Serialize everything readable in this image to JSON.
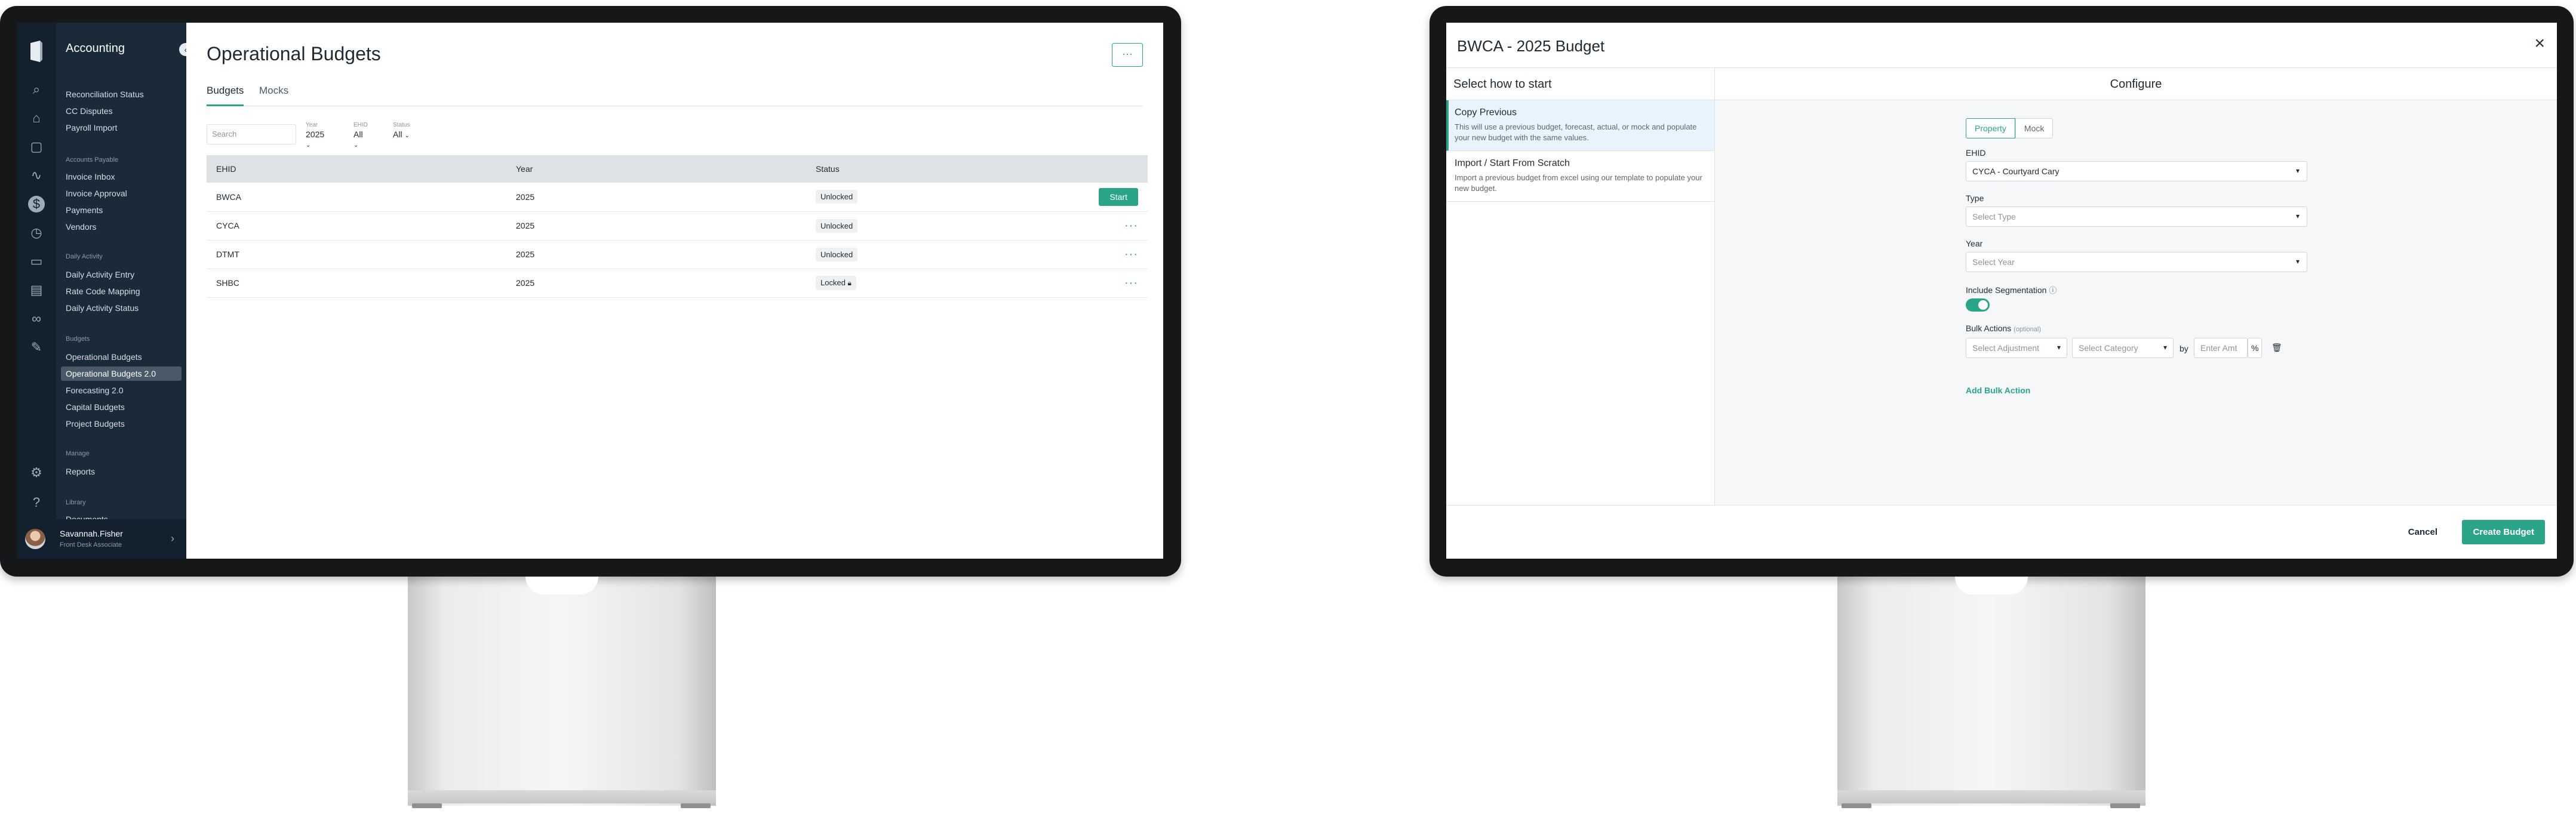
{
  "left_app": {
    "app_title": "Accounting",
    "sidebar": {
      "sections": [
        {
          "title": "",
          "items": [
            "Reconciliation Status",
            "CC Disputes",
            "Payroll Import"
          ]
        },
        {
          "title": "Accounts Payable",
          "items": [
            "Invoice Inbox",
            "Invoice Approval",
            "Payments",
            "Vendors"
          ]
        },
        {
          "title": "Daily Activity",
          "items": [
            "Daily Activity Entry",
            "Rate Code Mapping",
            "Daily Activity Status"
          ]
        },
        {
          "title": "Budgets",
          "items": [
            "Operational Budgets",
            "Operational Budgets 2.0",
            "Forecasting 2.0",
            "Capital Budgets",
            "Project Budgets"
          ]
        },
        {
          "title": "Manage",
          "items": [
            "Reports"
          ]
        },
        {
          "title": "Library",
          "items": [
            "Documents"
          ]
        }
      ],
      "selected_item": "Operational Budgets 2.0"
    },
    "user": {
      "name": "Savannah.Fisher",
      "role": "Front Desk Associate"
    },
    "page_title": "Operational Budgets",
    "more_label": "···",
    "tabs": [
      {
        "label": "Budgets",
        "active": true
      },
      {
        "label": "Mocks",
        "active": false
      }
    ],
    "search_placeholder": "Search",
    "filters": [
      {
        "label": "Year",
        "value": "2025"
      },
      {
        "label": "EHID",
        "value": "All"
      },
      {
        "label": "Status",
        "value": "All"
      }
    ],
    "table": {
      "columns": [
        "EHID",
        "Year",
        "Status"
      ],
      "rows": [
        {
          "ehid": "BWCA",
          "year": "2025",
          "status": "Unlocked",
          "action": "Start"
        },
        {
          "ehid": "CYCA",
          "year": "2025",
          "status": "Unlocked",
          "action": "···"
        },
        {
          "ehid": "DTMT",
          "year": "2025",
          "status": "Unlocked",
          "action": "···"
        },
        {
          "ehid": "SHBC",
          "year": "2025",
          "status": "Locked",
          "action": "···"
        }
      ]
    }
  },
  "modal": {
    "title": "BWCA - 2025 Budget",
    "close_label": "×",
    "left_heading": "Select how to start",
    "options": [
      {
        "title": "Copy Previous",
        "desc": "This will use a previous budget, forecast, actual, or mock and populate your new budget with the same values.",
        "selected": true
      },
      {
        "title": "Import / Start From Scratch",
        "desc": "Import a previous budget from excel using our template to populate your new budget.",
        "selected": false
      }
    ],
    "configure_heading": "Configure",
    "segments": [
      "Property",
      "Mock"
    ],
    "ehid_label": "EHID",
    "ehid_value": "CYCA - Courtyard Cary",
    "type_label": "Type",
    "type_placeholder": "Select Type",
    "year_label": "Year",
    "year_placeholder": "Select Year",
    "segmentation_label": "Include Segmentation",
    "bulk_label": "Bulk Actions",
    "bulk_optional": "(optional)",
    "bulk_adjustment": "Select Adjustment",
    "bulk_category": "Select Category",
    "bulk_by": "by",
    "bulk_amount": "Enter Amt",
    "bulk_pct": "%",
    "add_bulk": "Add Bulk Action",
    "cancel_label": "Cancel",
    "create_label": "Create Budget"
  },
  "colors": {
    "accent": "#2aa58a",
    "sidebar": "#1a2a39",
    "rail": "#13212e"
  }
}
